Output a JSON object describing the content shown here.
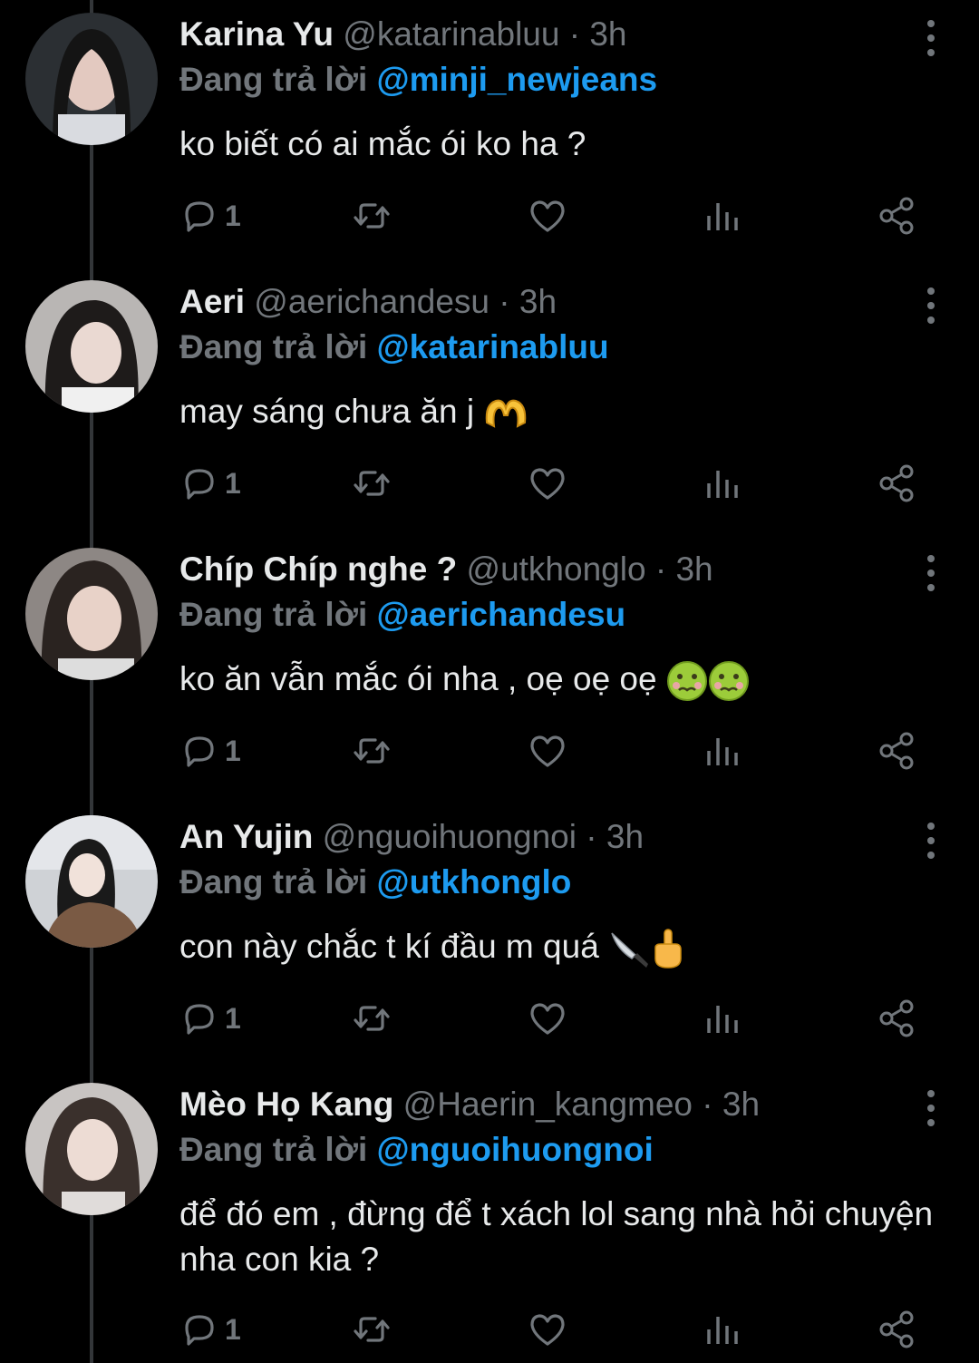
{
  "tweets": [
    {
      "name": "Karina Yu",
      "handle": "@katarinabluu",
      "time": "3h",
      "reply_prefix": "Đang trả lời",
      "reply_to": "@minji_newjeans",
      "text": "ko biết có ai mắc ói ko ha ?",
      "emojis": [],
      "reply_count": "1"
    },
    {
      "name": "Aeri",
      "handle": "@aerichandesu",
      "time": "3h",
      "reply_prefix": "Đang trả lời",
      "reply_to": "@katarinabluu",
      "text": "may sáng chưa ăn j ",
      "emojis": [
        "heart-hands-emoji"
      ],
      "reply_count": "1"
    },
    {
      "name": "Chíp Chíp nghe ?",
      "handle": "@utkhonglo",
      "time": "3h",
      "reply_prefix": "Đang trả lời",
      "reply_to": "@aerichandesu",
      "text": "ko ăn vẫn mắc ói nha , oẹ oẹ oẹ ",
      "emojis": [
        "nauseated-face-emoji",
        "nauseated-face-emoji"
      ],
      "reply_count": "1"
    },
    {
      "name": "An Yujin",
      "handle": "@nguoihuongnoi",
      "time": "3h",
      "reply_prefix": "Đang trả lời",
      "reply_to": "@utkhonglo",
      "text": "con này chắc t kí đầu m quá ",
      "emojis": [
        "knife-emoji",
        "middle-finger-emoji"
      ],
      "reply_count": "1"
    },
    {
      "name": "Mèo Họ Kang",
      "handle": "@Haerin_kangmeo",
      "time": "3h",
      "reply_prefix": "Đang trả lời",
      "reply_to": "@nguoihuongnoi",
      "text": "để đó em , đừng để t xách lol sang nhà hỏi chuyện nha con kia ?",
      "emojis": [],
      "reply_count": "1"
    }
  ],
  "separator": " · ",
  "colors": {
    "background": "#000000",
    "text": "#e7e9ea",
    "muted": "#71767b",
    "link": "#1d9bf0",
    "thread_line": "#333639"
  },
  "icons": [
    "reply-icon",
    "retweet-icon",
    "like-icon",
    "views-icon",
    "share-icon",
    "more-icon"
  ]
}
